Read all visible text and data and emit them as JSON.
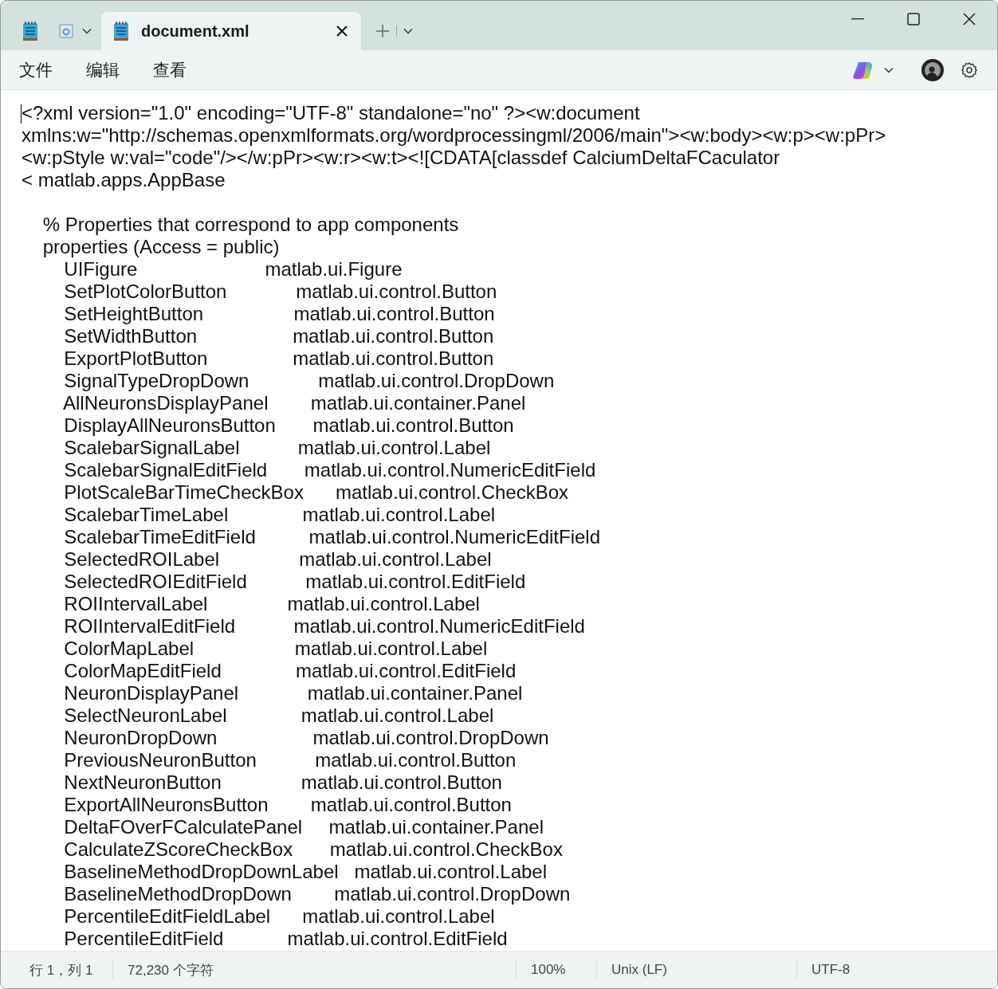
{
  "title_bar": {
    "tabs": [
      {
        "title": "document.xml",
        "selected": true
      }
    ]
  },
  "menu": [
    "文件",
    "编辑",
    "查看"
  ],
  "editor": {
    "blocks": [
      [
        "<?xml version=\"1.0\" encoding=\"UTF-8\" standalone=\"no\" ?><w:document",
        "xmlns:w=\"http://schemas.openxmlformats.org/wordprocessingml/2006/main\"><w:body><w:p><w:pPr>",
        "<w:pStyle w:val=\"code\"/></w:pPr><w:r><w:t><![CDATA[classdef CalciumDeltaFCaculator",
        "< matlab.apps.AppBase"
      ],
      [
        "    % Properties that correspond to app components",
        "    properties (Access = public)",
        "        UIFigure                        matlab.ui.Figure",
        "        SetPlotColorButton             matlab.ui.control.Button",
        "        SetHeightButton                 matlab.ui.control.Button",
        "        SetWidthButton                  matlab.ui.control.Button",
        "        ExportPlotButton                matlab.ui.control.Button",
        "        SignalTypeDropDown             matlab.ui.control.DropDown",
        "        AllNeuronsDisplayPanel        matlab.ui.container.Panel",
        "        DisplayAllNeuronsButton       matlab.ui.control.Button",
        "        ScalebarSignalLabel           matlab.ui.control.Label",
        "        ScalebarSignalEditField       matlab.ui.control.NumericEditField",
        "        PlotScaleBarTimeCheckBox      matlab.ui.control.CheckBox",
        "        ScalebarTimeLabel              matlab.ui.control.Label",
        "        ScalebarTimeEditField          matlab.ui.control.NumericEditField",
        "        SelectedROILabel               matlab.ui.control.Label",
        "        SelectedROIEditField           matlab.ui.control.EditField",
        "        ROIIntervalLabel               matlab.ui.control.Label",
        "        ROIIntervalEditField           matlab.ui.control.NumericEditField",
        "        ColorMapLabel                   matlab.ui.control.Label",
        "        ColorMapEditField              matlab.ui.control.EditField",
        "        NeuronDisplayPanel             matlab.ui.container.Panel",
        "        SelectNeuronLabel              matlab.ui.control.Label",
        "        NeuronDropDown                  matlab.ui.control.DropDown",
        "        PreviousNeuronButton           matlab.ui.control.Button",
        "        NextNeuronButton               matlab.ui.control.Button",
        "        ExportAllNeuronsButton        matlab.ui.control.Button",
        "        DeltaFOverFCalculatePanel     matlab.ui.container.Panel",
        "        CalculateZScoreCheckBox       matlab.ui.control.CheckBox",
        "        BaselineMethodDropDownLabel   matlab.ui.control.Label",
        "        BaselineMethodDropDown        matlab.ui.control.DropDown",
        "        PercentileEditFieldLabel      matlab.ui.control.Label",
        "        PercentileEditField            matlab.ui.control.EditField"
      ]
    ]
  },
  "status_bar": {
    "position": "行 1，列 1",
    "characters": "72,230 个字符",
    "zoom": "100%",
    "line_endings": "Unix (LF)",
    "encoding": "UTF-8"
  }
}
